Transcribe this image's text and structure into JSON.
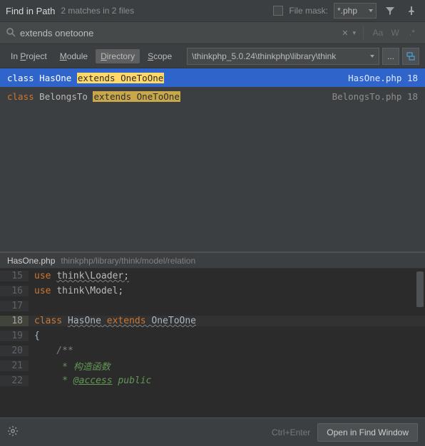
{
  "header": {
    "title": "Find in Path",
    "subtitle": "2 matches in 2 files",
    "mask_label": "File mask:",
    "mask_value": "*.php"
  },
  "search": {
    "query": "extends onetoone",
    "opts": {
      "case": "Aa",
      "word": "W",
      "regex": ".*"
    }
  },
  "scope": {
    "in_project": "In Project",
    "module": "Module",
    "directory": "Directory",
    "scope_lbl": "Scope",
    "path": "\\thinkphp_5.0.24\\thinkphp\\library\\think",
    "more": "...",
    "recurse_icon": "recurse"
  },
  "results": [
    {
      "kw": "class",
      "name": "HasOne",
      "hl": "extends OneToOne",
      "file": "HasOne.php",
      "line": "18",
      "selected": true
    },
    {
      "kw": "class",
      "name": "BelongsTo",
      "hl": "extends OneToOne",
      "file": "BelongsTo.php",
      "line": "18",
      "selected": false
    }
  ],
  "preview": {
    "filename": "HasOne.php",
    "filepath": "thinkphp/library/think/model/relation"
  },
  "code": {
    "l15": {
      "n": "15",
      "t1": "use ",
      "t2": "think\\Loader;"
    },
    "l16": {
      "n": "16",
      "t1": "use ",
      "t2": "think\\Model;"
    },
    "l17": {
      "n": "17"
    },
    "l18": {
      "n": "18",
      "t1": "class ",
      "t2": "HasOne",
      "t3": " extends ",
      "t4": "OneToOne"
    },
    "l19": {
      "n": "19",
      "t1": "{"
    },
    "l20": {
      "n": "20",
      "t1": "    /**"
    },
    "l21": {
      "n": "21",
      "t1": "     * 构造函数"
    },
    "l22": {
      "n": "22",
      "t1": "     * ",
      "t2": "@access",
      "t3": " public"
    }
  },
  "footer": {
    "hint": "Ctrl+Enter",
    "open": "Open in Find Window"
  }
}
